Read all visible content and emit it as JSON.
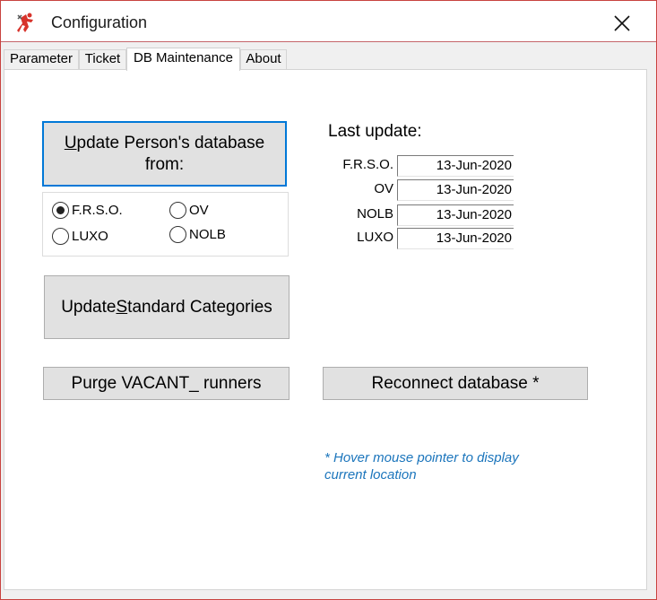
{
  "window": {
    "title": "Configuration",
    "accent": "#c8433f"
  },
  "tabs": [
    {
      "label": "Parameter",
      "active": false
    },
    {
      "label": "Ticket",
      "active": false
    },
    {
      "label": "DB Maintenance",
      "active": true
    },
    {
      "label": "About",
      "active": false
    }
  ],
  "buttons": {
    "update_person_u": "U",
    "update_person_rest1": "pdate Person's database",
    "update_person_line2": "from:",
    "update_std_pre": "Update ",
    "update_std_u": "S",
    "update_std_post": "tandard Categories",
    "purge": "Purge VACANT_ runners",
    "reconnect": "Reconnect database *"
  },
  "radios": [
    {
      "label": "F.R.S.O.",
      "checked": true
    },
    {
      "label": "OV",
      "checked": false
    },
    {
      "label": "LUXO",
      "checked": false
    },
    {
      "label": "NOLB",
      "checked": false
    }
  ],
  "last_update": {
    "title": "Last update:",
    "rows": [
      {
        "label": "F.R.S.O.",
        "value": "13-Jun-2020"
      },
      {
        "label": "OV",
        "value": "13-Jun-2020"
      },
      {
        "label": "NOLB",
        "value": "13-Jun-2020"
      },
      {
        "label": "LUXO",
        "value": "13-Jun-2020"
      }
    ]
  },
  "hint": "* Hover mouse pointer to display current location",
  "icons": {
    "app": "runner-logo-icon",
    "close": "close-icon"
  },
  "colors": {
    "hint": "#1b75bc",
    "focus_border": "#0078d7"
  }
}
